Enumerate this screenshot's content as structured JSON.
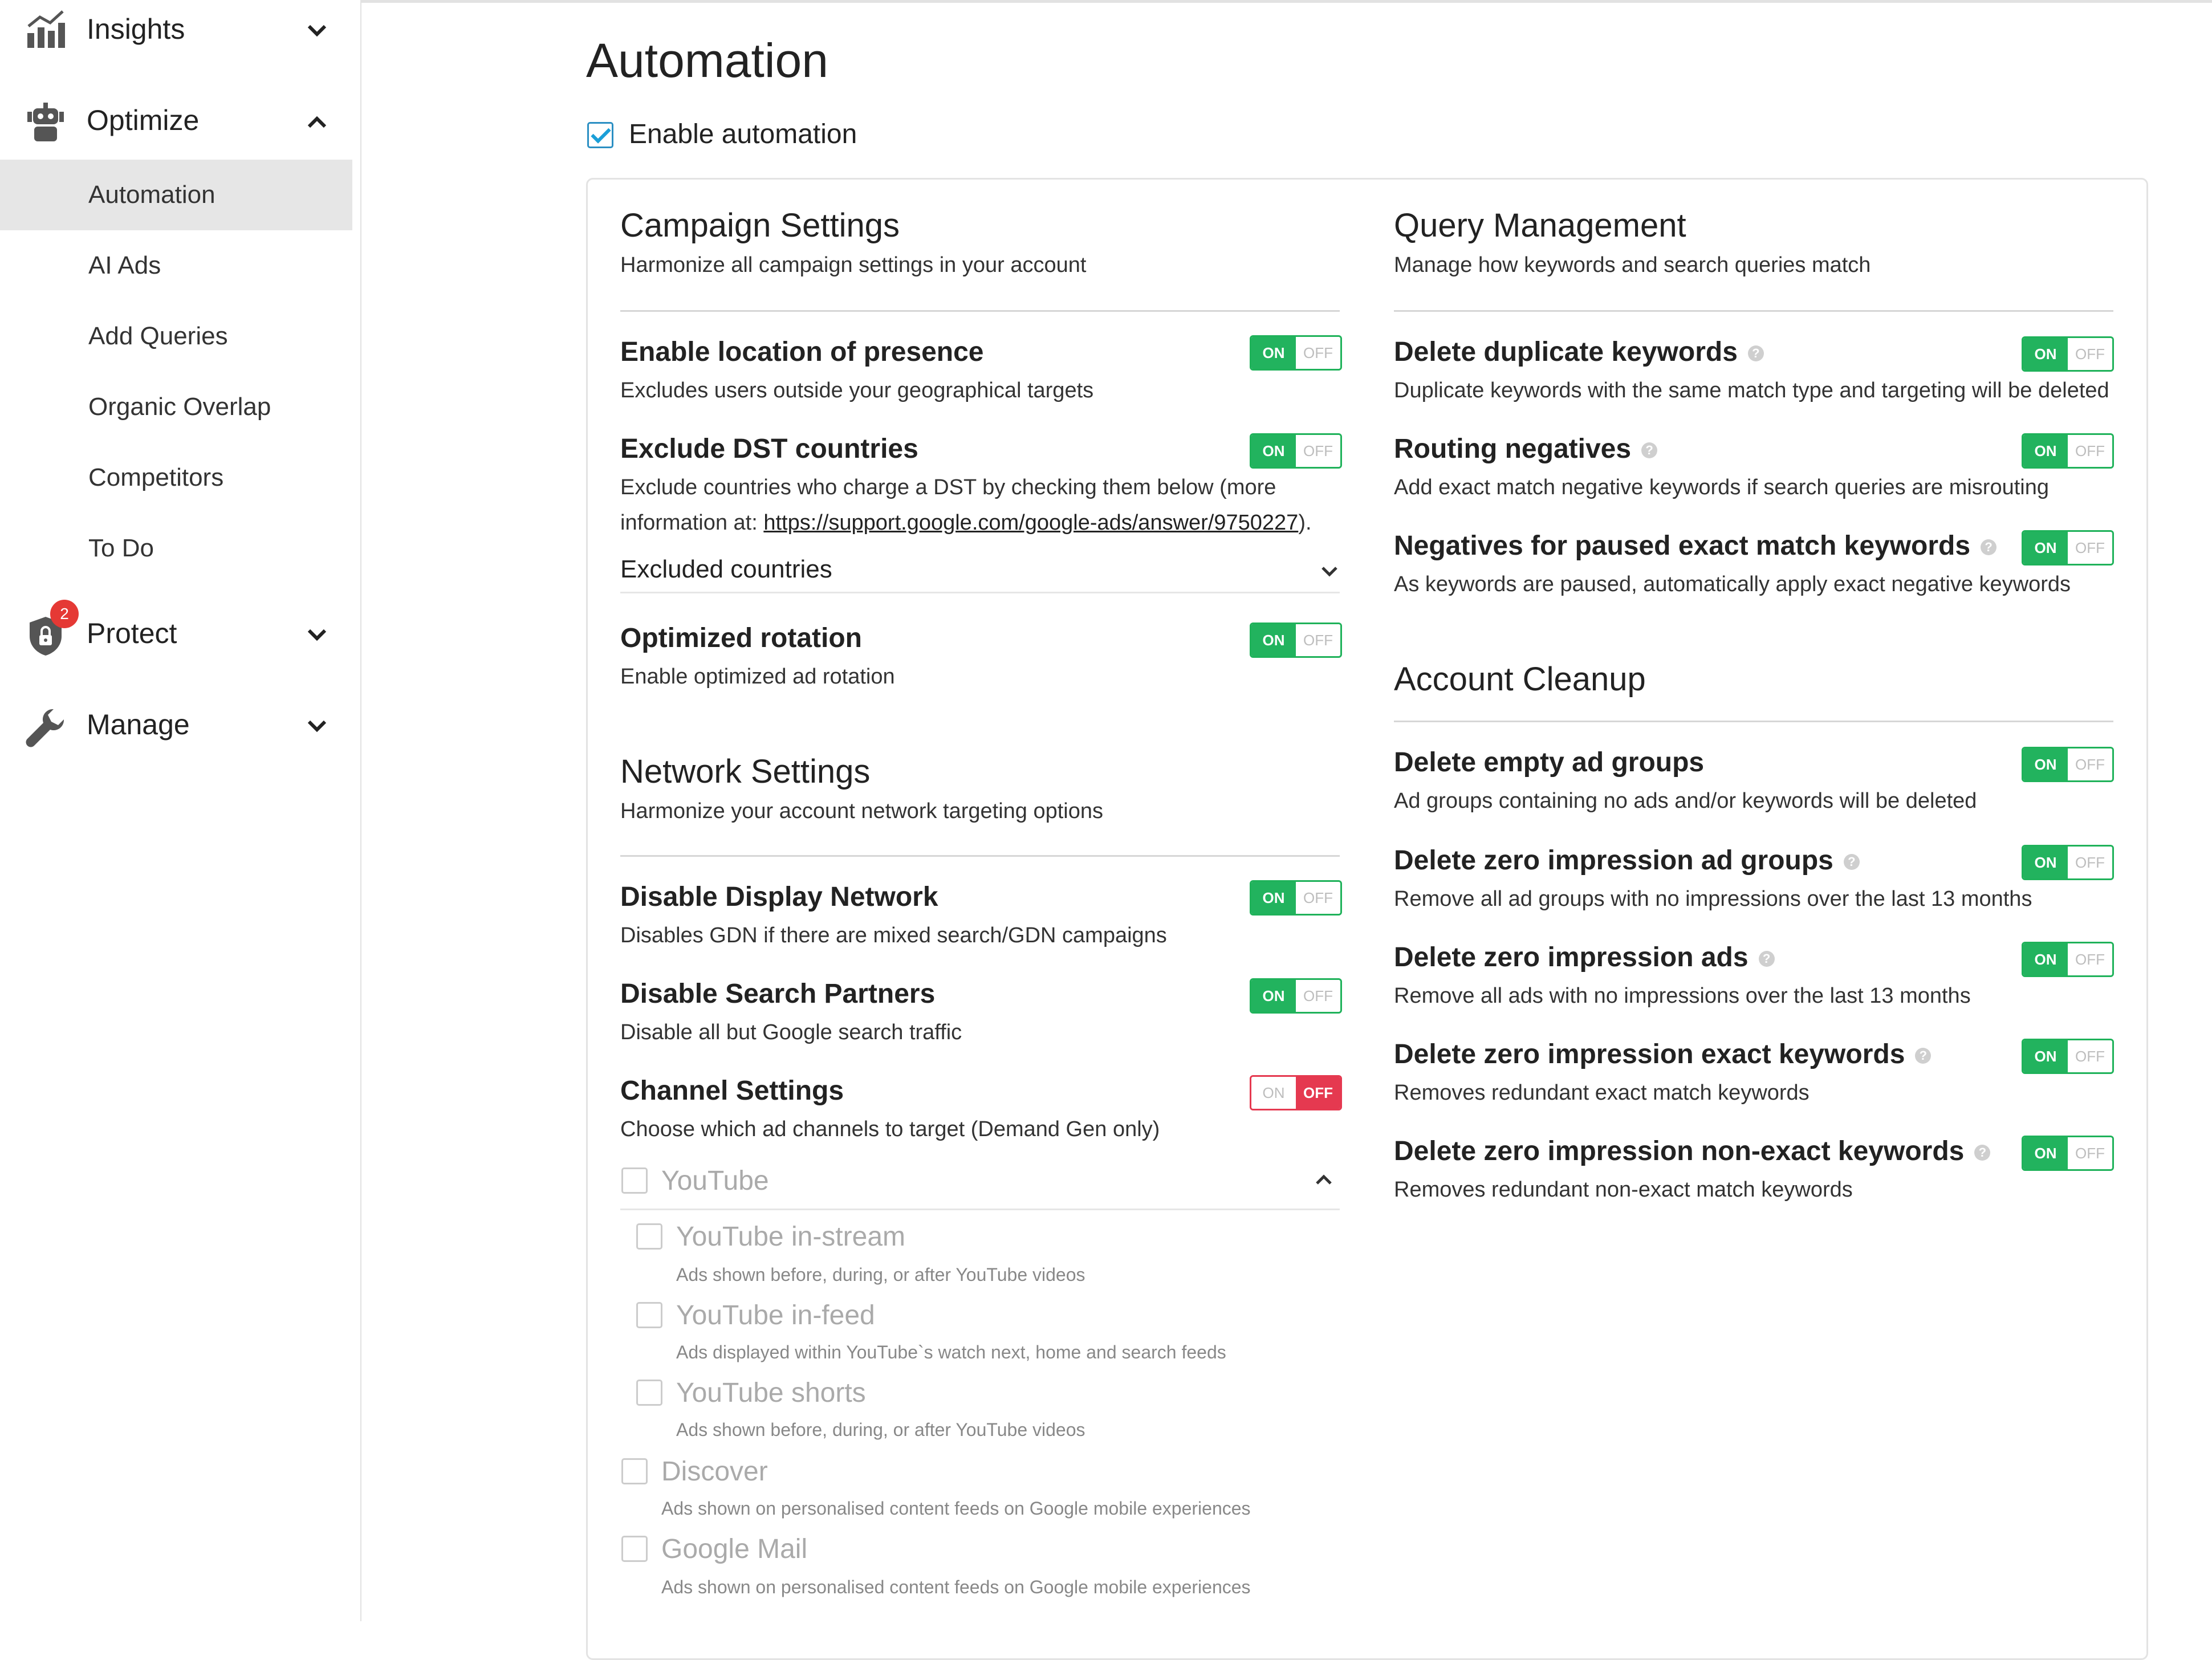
{
  "sidebar": {
    "insights": "Insights",
    "optimize": "Optimize",
    "sub_items": [
      "Automation",
      "AI Ads",
      "Add Queries",
      "Organic Overlap",
      "Competitors",
      "To Do"
    ],
    "protect": "Protect",
    "protect_badge": "2",
    "manage": "Manage"
  },
  "page": {
    "title": "Automation",
    "enable_label": "Enable automation"
  },
  "toggle_labels": {
    "on": "ON",
    "off": "OFF"
  },
  "campaign": {
    "title": "Campaign Settings",
    "subtitle": "Harmonize all campaign settings in your account",
    "location": {
      "title": "Enable location of presence",
      "desc": "Excludes users outside your geographical targets",
      "state": "on"
    },
    "dst": {
      "title": "Exclude DST countries",
      "desc1": "Exclude countries who charge a DST by checking them below (more",
      "desc2_prefix": "information at: ",
      "link": "https://support.google.com/google-ads/answer/9750227",
      "desc2_suffix": ").",
      "state": "on"
    },
    "excluded_countries": "Excluded countries",
    "rotation": {
      "title": "Optimized rotation",
      "desc": "Enable optimized ad rotation",
      "state": "on"
    }
  },
  "network": {
    "title": "Network Settings",
    "subtitle": "Harmonize your account network targeting options",
    "display": {
      "title": "Disable Display Network",
      "desc": "Disables GDN if there are mixed search/GDN campaigns",
      "state": "on"
    },
    "partners": {
      "title": "Disable Search Partners",
      "desc": "Disable all but Google search traffic",
      "state": "on"
    },
    "channel": {
      "title": "Channel Settings",
      "desc": "Choose which ad channels to target (Demand Gen only)",
      "state": "off"
    }
  },
  "channels": {
    "youtube": "YouTube",
    "instream": {
      "title": "YouTube in-stream",
      "desc": "Ads shown before, during, or after YouTube videos"
    },
    "infeed": {
      "title": "YouTube in-feed",
      "desc": "Ads displayed within YouTube`s watch next, home and search feeds"
    },
    "shorts": {
      "title": "YouTube shorts",
      "desc": "Ads shown before, during, or after YouTube videos"
    },
    "discover": {
      "title": "Discover",
      "desc": "Ads shown on personalised content feeds on Google mobile experiences"
    },
    "gmail": {
      "title": "Google Mail",
      "desc": "Ads shown on personalised content feeds on Google mobile experiences"
    }
  },
  "query": {
    "title": "Query Management",
    "subtitle": "Manage how keywords and search queries match",
    "duplicate": {
      "title": "Delete duplicate keywords",
      "desc": "Duplicate keywords with the same match type and targeting will be deleted",
      "state": "on"
    },
    "routing": {
      "title": "Routing negatives",
      "desc": "Add exact match negative keywords if search queries are misrouting",
      "state": "on"
    },
    "paused": {
      "title": "Negatives for paused exact match keywords",
      "desc": "As keywords are paused, automatically apply exact negative keywords",
      "state": "on"
    }
  },
  "cleanup": {
    "title": "Account Cleanup",
    "empty": {
      "title": "Delete empty ad groups",
      "desc": "Ad groups containing no ads and/or keywords will be deleted",
      "state": "on"
    },
    "zero_groups": {
      "title": "Delete zero impression ad groups",
      "desc": "Remove all ad groups with no impressions over the last 13 months",
      "state": "on"
    },
    "zero_ads": {
      "title": "Delete zero impression ads",
      "desc": "Remove all ads with no impressions over the last 13 months",
      "state": "on"
    },
    "zero_exact": {
      "title": "Delete zero impression exact keywords",
      "desc": "Removes redundant exact match keywords",
      "state": "on"
    },
    "zero_nonexact": {
      "title": "Delete zero impression non-exact keywords",
      "desc": "Removes redundant non-exact match keywords",
      "state": "on"
    }
  },
  "colors": {
    "accent_on": "#22b35e",
    "accent_off": "#e53950",
    "checkbox": "#1b9fd8",
    "active_nav": "#e6e6e6"
  }
}
